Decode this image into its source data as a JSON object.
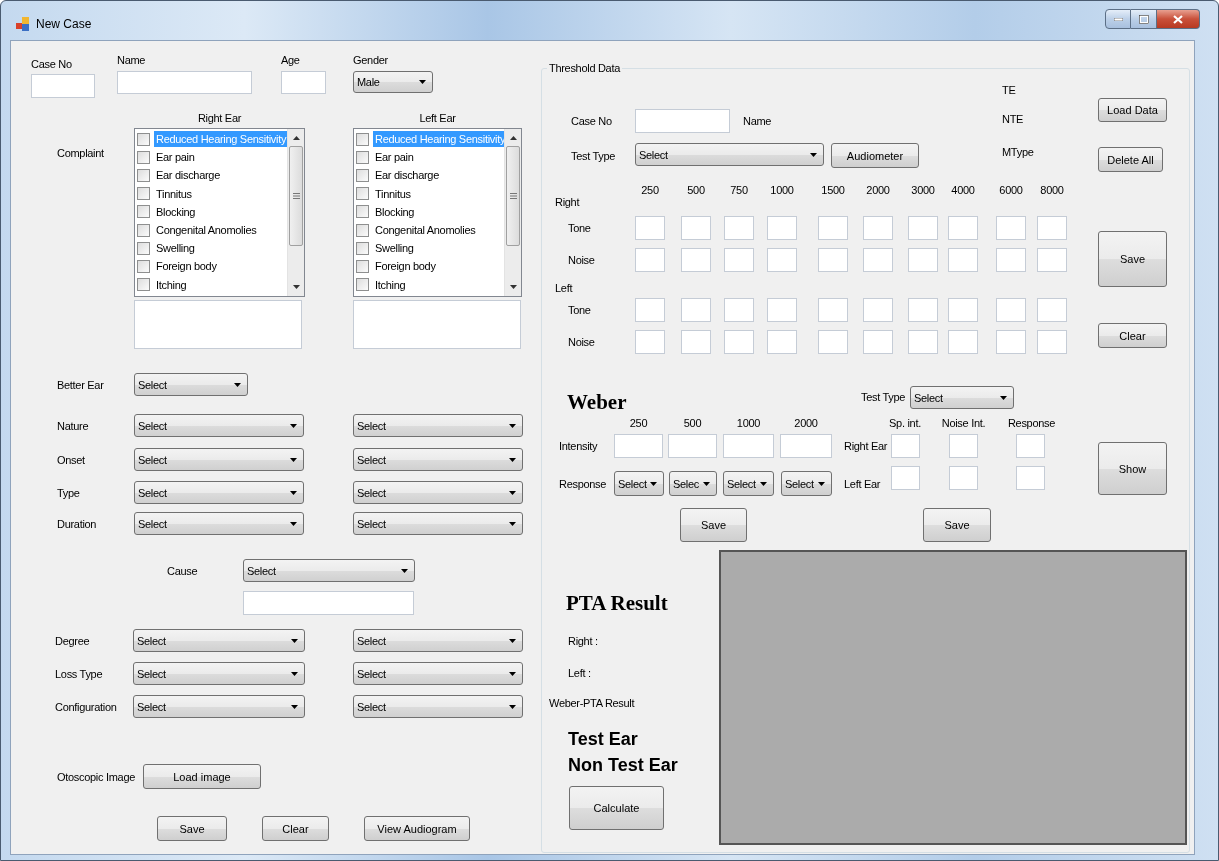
{
  "window": {
    "title": "New Case"
  },
  "patient_fields": [
    {
      "kind": "text",
      "label": "Case No"
    },
    {
      "kind": "text",
      "label": "Name"
    },
    {
      "kind": "text",
      "label": "Age"
    },
    {
      "kind": "dropdown",
      "label": "Gender",
      "value": "Male"
    }
  ],
  "complaint": {
    "label": "Complaint",
    "ears": [
      {
        "heading": "Right Ear",
        "items": [
          {
            "label": "Reduced Hearing Sensitivity",
            "checked": false,
            "selected": true
          },
          {
            "label": "Ear pain",
            "checked": false,
            "selected": false
          },
          {
            "label": "Ear discharge",
            "checked": false,
            "selected": false
          },
          {
            "label": "Tinnitus",
            "checked": false,
            "selected": false
          },
          {
            "label": "Blocking",
            "checked": false,
            "selected": false
          },
          {
            "label": "Congenital Anomolies",
            "checked": false,
            "selected": false
          },
          {
            "label": "Swelling",
            "checked": false,
            "selected": false
          },
          {
            "label": "Foreign body",
            "checked": false,
            "selected": false
          },
          {
            "label": "Itching",
            "checked": false,
            "selected": false
          }
        ]
      },
      {
        "heading": "Left Ear",
        "items": [
          {
            "label": "Reduced Hearing Sensitivity",
            "checked": false,
            "selected": true
          },
          {
            "label": "Ear pain",
            "checked": false,
            "selected": false
          },
          {
            "label": "Ear discharge",
            "checked": false,
            "selected": false
          },
          {
            "label": "Tinnitus",
            "checked": false,
            "selected": false
          },
          {
            "label": "Blocking",
            "checked": false,
            "selected": false
          },
          {
            "label": "Congenital Anomolies",
            "checked": false,
            "selected": false
          },
          {
            "label": "Swelling",
            "checked": false,
            "selected": false
          },
          {
            "label": "Foreign body",
            "checked": false,
            "selected": false
          },
          {
            "label": "Itching",
            "checked": false,
            "selected": false
          }
        ]
      }
    ]
  },
  "better_ear": {
    "label": "Better Ear",
    "value": "Select"
  },
  "ear_fields": [
    {
      "label": "Nature",
      "right": "Select",
      "left": "Select"
    },
    {
      "label": "Onset",
      "right": "Select",
      "left": "Select"
    },
    {
      "label": "Type",
      "right": "Select",
      "left": "Select"
    },
    {
      "label": "Duration",
      "right": "Select",
      "left": "Select"
    }
  ],
  "cause": {
    "label": "Cause",
    "value": "Select"
  },
  "loss_fields": [
    {
      "label": "Degree",
      "right": "Select",
      "left": "Select"
    },
    {
      "label": "Loss Type",
      "right": "Select",
      "left": "Select"
    },
    {
      "label": "Configuration",
      "right": "Select",
      "left": "Select"
    }
  ],
  "otoscopic": {
    "label": "Otoscopic Image",
    "button": "Load image"
  },
  "actions": [
    "Save",
    "Clear",
    "View Audiogram"
  ],
  "threshold": {
    "title": "Threshold Data",
    "case_no_label": "Case No",
    "name_label": "Name",
    "test_type_label": "Test Type",
    "test_type_value": "Select",
    "audiometer_button": "Audiometer",
    "indicators": [
      "TE",
      "NTE",
      "MType"
    ],
    "frequencies": [
      "250",
      "500",
      "750",
      "1000",
      "1500",
      "2000",
      "3000",
      "4000",
      "6000",
      "8000"
    ],
    "sides": [
      {
        "label": "Right",
        "rows": [
          "Tone",
          "Noise"
        ]
      },
      {
        "label": "Left",
        "rows": [
          "Tone",
          "Noise"
        ]
      }
    ],
    "buttons": {
      "load": "Load Data",
      "delete": "Delete All",
      "save": "Save",
      "clear": "Clear",
      "show": "Show"
    }
  },
  "weber": {
    "title": "Weber",
    "frequencies": [
      "250",
      "500",
      "1000",
      "2000"
    ],
    "intensity_label": "Intensity",
    "response_label": "Response",
    "responses": [
      "Select",
      "Selec",
      "Select",
      "Select"
    ],
    "test_type_label": "Test Type",
    "test_type_value": "Select",
    "columns": [
      "Sp. int.",
      "Noise Int.",
      "Response"
    ],
    "ears": [
      "Right Ear",
      "Left Ear"
    ],
    "save_buttons": [
      "Save",
      "Save"
    ]
  },
  "pta": {
    "title": "PTA Result",
    "right_label": "Right :",
    "left_label": "Left :",
    "weber_pta_label": "Weber-PTA Result",
    "test_ear": "Test Ear",
    "non_test_ear": "Non Test Ear",
    "calculate_button": "Calculate"
  }
}
